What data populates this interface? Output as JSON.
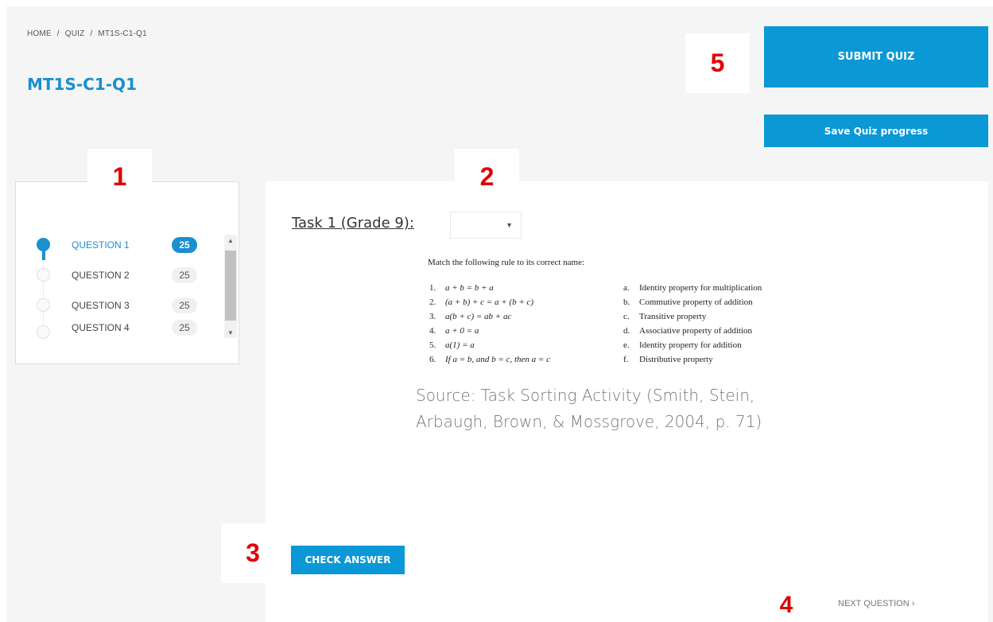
{
  "breadcrumb": [
    "HOME",
    "/",
    "QUIZ",
    "/",
    "MT1S-C1-Q1"
  ],
  "page_title": "MT1S-C1-Q1",
  "header": {
    "submit_label": "SUBMIT QUIZ",
    "save_label": "Save Quiz progress"
  },
  "markers": [
    "1",
    "2",
    "3",
    "4",
    "5"
  ],
  "questions": [
    {
      "label": "QUESTION 1",
      "score": "25",
      "active": true
    },
    {
      "label": "QUESTION 2",
      "score": "25",
      "active": false
    },
    {
      "label": "QUESTION 3",
      "score": "25",
      "active": false
    },
    {
      "label": "QUESTION 4",
      "score": "25",
      "active": false
    }
  ],
  "task": {
    "title": "Task 1 (Grade 9):",
    "select_value": "",
    "image": {
      "heading": "Match the following rule to its correct name:",
      "rows": [
        {
          "num": "1.",
          "rule": "a + b = b + a",
          "letter": "a.",
          "name": "Identity property for multiplication"
        },
        {
          "num": "2.",
          "rule": "(a + b) + c = a + (b + c)",
          "letter": "b.",
          "name": "Commutive property of addition"
        },
        {
          "num": "3.",
          "rule": "a(b + c) = ab + ac",
          "letter": "c.",
          "name": "Transitive property"
        },
        {
          "num": "4.",
          "rule": "a + 0 = a",
          "letter": "d.",
          "name": "Associative property of addition"
        },
        {
          "num": "5.",
          "rule": "a(1) = a",
          "letter": "e.",
          "name": "Identity property for addition"
        },
        {
          "num": "6.",
          "rule": "If a = b, and b = c, then a = c",
          "letter": "f.",
          "name": "Distributive property"
        }
      ]
    },
    "source": "Source: Task Sorting Activity (Smith, Stein, Arbaugh, Brown, & Mossgrove, 2004, p. 71)"
  },
  "check_answer_label": "CHECK ANSWER",
  "next_question_label": "NEXT QUESTION ›",
  "colors": {
    "accent": "#0a98d6",
    "marker": "#e00000"
  }
}
